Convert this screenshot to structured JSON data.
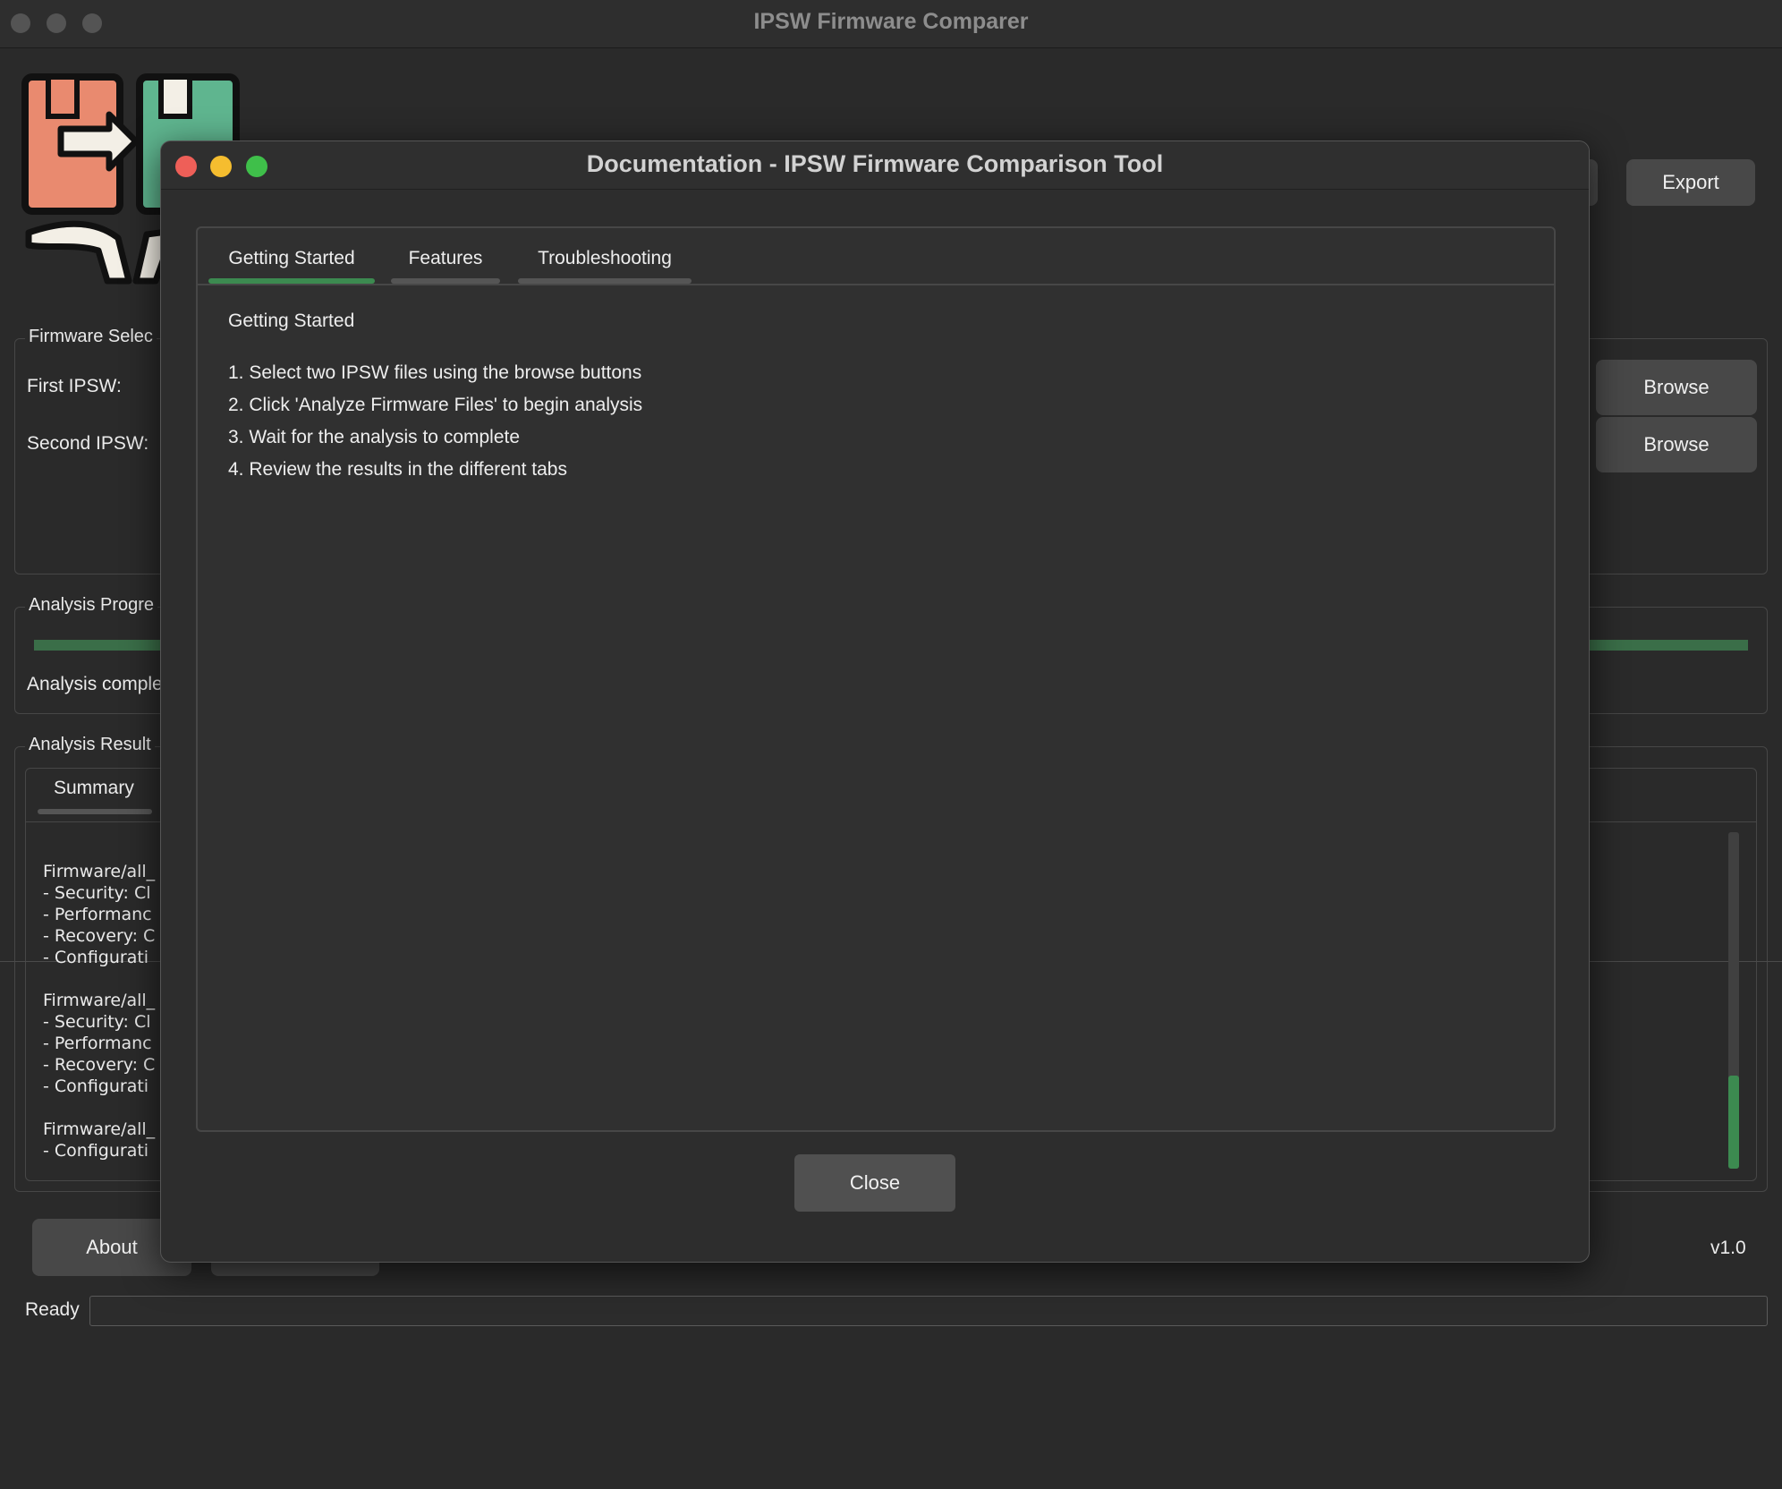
{
  "window": {
    "title": "IPSW Firmware Comparer"
  },
  "toolbar": {
    "export_label": "Export"
  },
  "firmware_selection": {
    "legend": "Firmware Selec",
    "first_label": "First IPSW:",
    "second_label": "Second IPSW:",
    "browse_label": "Browse"
  },
  "progress": {
    "legend": "Analysis Progre",
    "status": "Analysis comple",
    "value": 1.0
  },
  "results": {
    "legend": "Analysis Result",
    "tab_summary": "Summary",
    "blocks": [
      "Firmware/all_\n- Security: Cl\n- Performanc\n- Recovery: C\n- Configurati",
      "Firmware/all_\n- Security: Cl\n- Performanc\n- Recovery: C\n- Configurati",
      "Firmware/all_\n- Configurati"
    ]
  },
  "footer": {
    "about_label": "About",
    "version": "v1.0",
    "status": "Ready"
  },
  "dialog": {
    "title": "Documentation - IPSW Firmware Comparison Tool",
    "tabs": [
      "Getting Started",
      "Features",
      "Troubleshooting"
    ],
    "active_tab": "Getting Started",
    "heading": "Getting Started",
    "steps": [
      "1. Select two IPSW files using the browse buttons",
      "2. Click 'Analyze Firmware Files' to begin analysis",
      "3. Wait for the analysis to complete",
      "4. Review the results in the different tabs"
    ],
    "close_label": "Close"
  },
  "colors": {
    "accent_green": "#3c8a50",
    "close_red": "#ee5f58",
    "minimize_yellow": "#f5bd2f",
    "zoom_green": "#3fbf4a"
  },
  "icons": [
    "firmware-compare-logo"
  ]
}
